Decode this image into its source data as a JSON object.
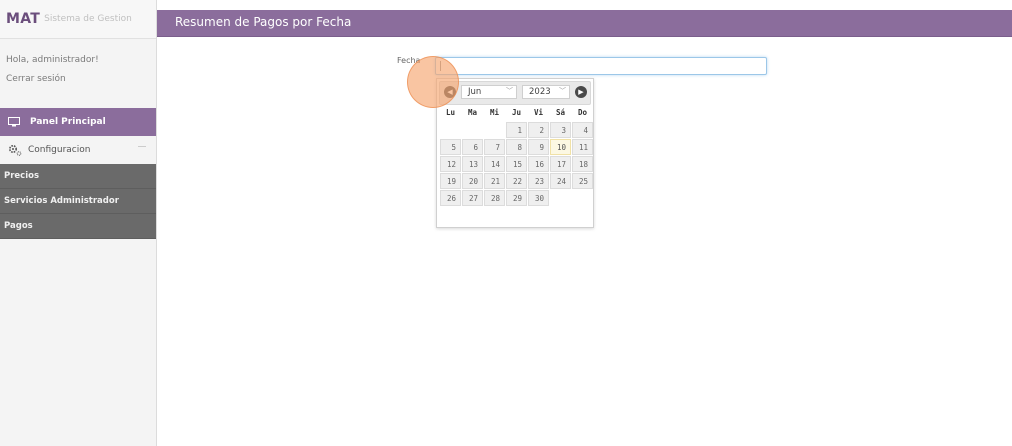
{
  "sidebar": {
    "brand": {
      "logo": "MAT",
      "subtitle": "Sistema de Gestion"
    },
    "greeting": "Hola, administrador!",
    "logout": "Cerrar sesión",
    "nav": {
      "main_label": "Panel Principal",
      "config_label": "Configuracion",
      "submenu": [
        "Precios",
        "Servicios Administrador",
        "Pagos"
      ]
    }
  },
  "header": {
    "title": "Resumen de Pagos por Fecha"
  },
  "form": {
    "field_label": "Fecha",
    "field_value": ""
  },
  "datepicker": {
    "prev_label": "◀",
    "next_label": "▶",
    "month": "Jun",
    "year": "2023",
    "weekdays": [
      "Lu",
      "Ma",
      "Mi",
      "Ju",
      "Vi",
      "Sá",
      "Do"
    ],
    "leading_blanks": 3,
    "days": [
      "1",
      "2",
      "3",
      "4",
      "5",
      "6",
      "7",
      "8",
      "9",
      "10",
      "11",
      "12",
      "13",
      "14",
      "15",
      "16",
      "17",
      "18",
      "19",
      "20",
      "21",
      "22",
      "23",
      "24",
      "25",
      "26",
      "27",
      "28",
      "29",
      "30"
    ],
    "highlighted_day": "10"
  },
  "colors": {
    "accent": "#8b6d9c",
    "submenu_bg": "#6a6a6a",
    "today_bg": "#fcf8e3"
  }
}
